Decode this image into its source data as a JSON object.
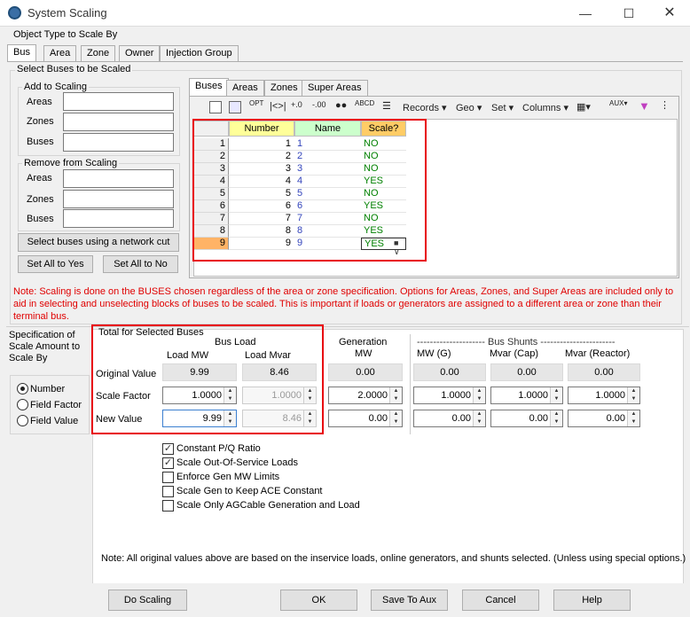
{
  "window": {
    "title": "System Scaling"
  },
  "object_type": {
    "label": "Object Type to Scale By",
    "tabs": [
      "Bus",
      "Area",
      "Zone",
      "Owner",
      "Injection Group"
    ]
  },
  "select_buses": {
    "label": "Select Buses to be Scaled",
    "add_group": {
      "label": "Add to Scaling",
      "fields": [
        "Areas",
        "Zones",
        "Buses"
      ]
    },
    "remove_group": {
      "label": "Remove from Scaling",
      "fields": [
        "Areas",
        "Zones",
        "Buses"
      ]
    },
    "network_cut_button": "Select buses using a network cut",
    "set_all_yes_button": "Set All to Yes",
    "set_all_no_button": "Set All to No"
  },
  "grid_tabs": [
    "Buses",
    "Areas",
    "Zones",
    "Super Areas"
  ],
  "toolbar": {
    "records": "Records",
    "geo": "Geo",
    "set": "Set",
    "columns": "Columns"
  },
  "grid": {
    "headers": [
      "Number",
      "Name",
      "Scale?"
    ],
    "rows": [
      {
        "row": "1",
        "number": "1",
        "name": "1",
        "scale": "NO"
      },
      {
        "row": "2",
        "number": "2",
        "name": "2",
        "scale": "NO"
      },
      {
        "row": "3",
        "number": "3",
        "name": "3",
        "scale": "NO"
      },
      {
        "row": "4",
        "number": "4",
        "name": "4",
        "scale": "YES"
      },
      {
        "row": "5",
        "number": "5",
        "name": "5",
        "scale": "NO"
      },
      {
        "row": "6",
        "number": "6",
        "name": "6",
        "scale": "YES"
      },
      {
        "row": "7",
        "number": "7",
        "name": "7",
        "scale": "NO"
      },
      {
        "row": "8",
        "number": "8",
        "name": "8",
        "scale": "YES"
      },
      {
        "row": "9",
        "number": "9",
        "name": "9",
        "scale": "YES"
      }
    ]
  },
  "note1": "Note: Scaling is done on the BUSES chosen regardless of the area or zone specification.  Options for Areas, Zones, and Super Areas are included only to aid in selecting and unselecting blocks of buses to be scaled. This is important if loads or generators are assigned to a different area or zone than their terminal bus.",
  "spec": {
    "label": "Specification of Scale Amount to Scale By",
    "options": [
      "Number",
      "Field Factor",
      "Field Value"
    ],
    "selected": "Number"
  },
  "totals": {
    "label": "Total for Selected Buses",
    "bus_load": "Bus Load",
    "load_mw": "Load MW",
    "load_mvar": "Load Mvar",
    "generation": "Generation",
    "gen_mw": "MW",
    "bus_shunts": "--------------------- Bus Shunts -----------------------",
    "shunt_mw": "MW (G)",
    "shunt_cap": "Mvar (Cap)",
    "shunt_reactor": "Mvar (Reactor)",
    "row_labels": [
      "Original Value",
      "Scale Factor",
      "New Value"
    ],
    "original": {
      "load_mw": "9.99",
      "load_mvar": "8.46",
      "gen_mw": "0.00",
      "shunt_mw": "0.00",
      "shunt_cap": "0.00",
      "shunt_reactor": "0.00"
    },
    "factor": {
      "load_mw": "1.0000",
      "load_mvar": "1.0000",
      "gen_mw": "2.0000",
      "shunt_mw": "1.0000",
      "shunt_cap": "1.0000",
      "shunt_reactor": "1.0000"
    },
    "new": {
      "load_mw": "9.99",
      "load_mvar": "8.46",
      "gen_mw": "0.00",
      "shunt_mw": "0.00",
      "shunt_cap": "0.00",
      "shunt_reactor": "0.00"
    }
  },
  "options": [
    {
      "label": "Constant P/Q Ratio",
      "checked": true
    },
    {
      "label": "Scale Out-Of-Service Loads",
      "checked": true
    },
    {
      "label": "Enforce Gen MW Limits",
      "checked": false
    },
    {
      "label": "Scale Gen to Keep ACE Constant",
      "checked": false
    },
    {
      "label": "Scale Only AGCable Generation and Load",
      "checked": false
    }
  ],
  "note2": "Note:  All original values above are based on the inservice loads, online generators, and shunts selected.  (Unless using special options.)",
  "buttons": {
    "do_scaling": "Do Scaling",
    "ok": "OK",
    "save_aux": "Save To Aux",
    "cancel": "Cancel",
    "help": "Help"
  },
  "colors": {
    "highlight_red": "#e8000b",
    "number_header": "#ffff99",
    "name_header": "#ccffcc",
    "scale_header": "#ffcc66",
    "yes_no_green": "#008000",
    "note_red": "#e00000"
  }
}
